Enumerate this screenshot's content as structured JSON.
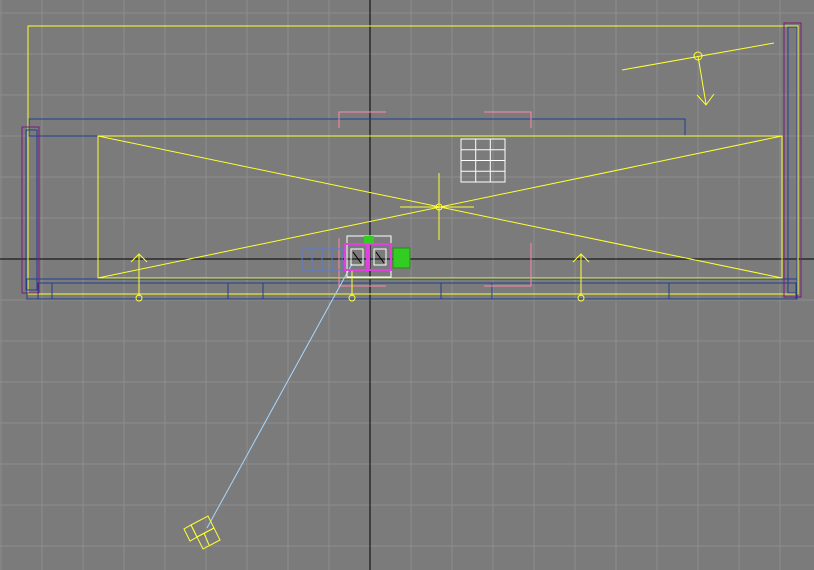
{
  "viewport": {
    "background_color": "#7b7b7b",
    "grid_color": "#8c8c8c",
    "axis_color": "#000000",
    "grid_visible": true
  },
  "colors": {
    "selection_yellow": "#ffff33",
    "wall_blue": "#1f3f8f",
    "frame_purple": "#7a1a7a",
    "camera_pink": "#ff8aa8",
    "light_line": "#a8d8ff",
    "window_white": "#ffffff",
    "accent_green": "#33cc22",
    "model_magenta": "#e040e0"
  },
  "scene_objects": [
    {
      "id": "upper-room-boundary",
      "kind": "rectangle-outline"
    },
    {
      "id": "wall-strip-top",
      "kind": "rectangle-outline"
    },
    {
      "id": "floor-plane-x-brace",
      "kind": "cross-braced-rectangle"
    },
    {
      "id": "wall-strip-bottom",
      "kind": "segmented-rectangle"
    },
    {
      "id": "left-column",
      "kind": "rectangle-outline"
    },
    {
      "id": "right-column",
      "kind": "rectangle-outline"
    },
    {
      "id": "camera-frame",
      "kind": "corner-brackets"
    },
    {
      "id": "window-grid",
      "kind": "grid-3x4"
    },
    {
      "id": "directional-light",
      "kind": "light-gizmo"
    },
    {
      "id": "spot-lights",
      "kind": "arrow-gizmos",
      "count": 3
    },
    {
      "id": "furniture-group",
      "kind": "mesh-cluster"
    },
    {
      "id": "target-camera",
      "kind": "camera-gizmo"
    }
  ]
}
